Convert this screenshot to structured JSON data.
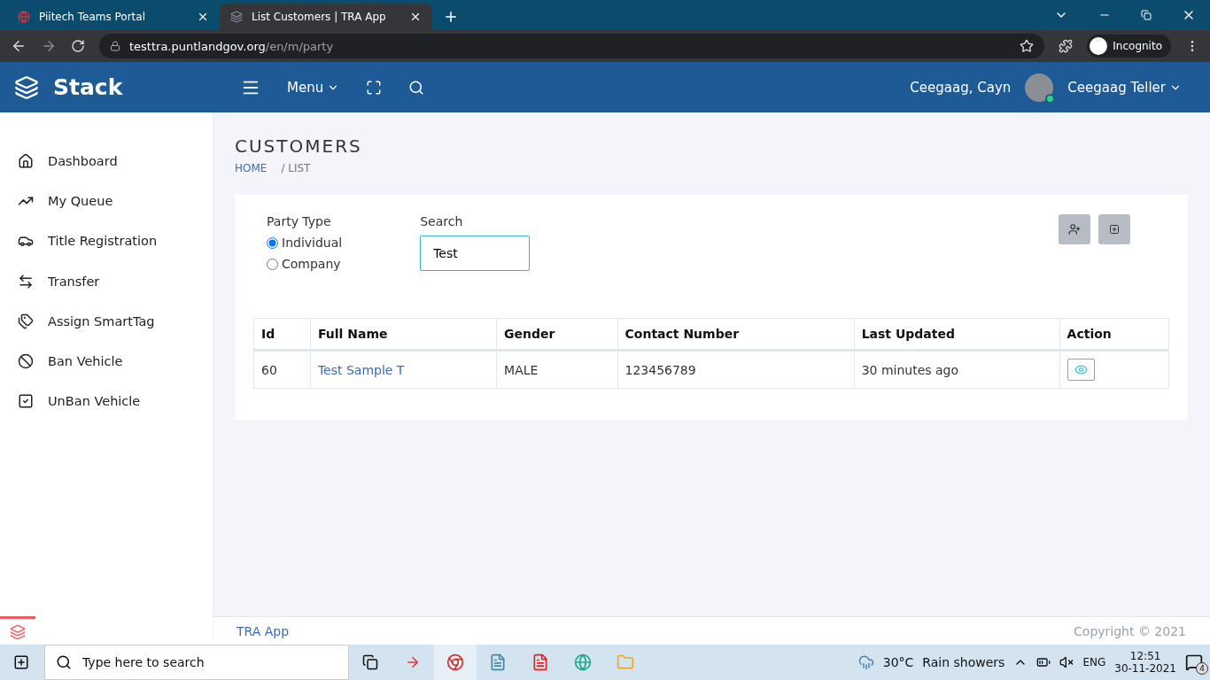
{
  "browser": {
    "tabs": [
      {
        "title": "Piitech Teams Portal",
        "selected": false
      },
      {
        "title": "List Customers | TRA App",
        "selected": true
      }
    ],
    "address": {
      "host": "testtra.puntlandgov.org",
      "path": "/en/m/party"
    },
    "profile": "Incognito"
  },
  "header": {
    "brand": "Stack",
    "menu": "Menu",
    "user_short": "Ceegaag, Cayn",
    "user_name": "Ceegaag Teller",
    "online": true
  },
  "sidebar": {
    "items": [
      {
        "label": "Dashboard"
      },
      {
        "label": "My Queue"
      },
      {
        "label": "Title Registration"
      },
      {
        "label": "Transfer"
      },
      {
        "label": "Assign SmartTag"
      },
      {
        "label": "Ban Vehicle"
      },
      {
        "label": "UnBan Vehicle"
      }
    ]
  },
  "page": {
    "title": "CUSTOMERS",
    "breadcrumb": [
      {
        "label": "HOME",
        "link": true
      },
      {
        "label": "/ LIST",
        "link": false
      }
    ]
  },
  "filters": {
    "party_type_label": "Party Type",
    "options": [
      {
        "label": "Individual",
        "selected": true
      },
      {
        "label": "Company",
        "selected": false
      }
    ],
    "search_label": "Search",
    "search_value": "Test"
  },
  "table": {
    "columns": [
      "Id",
      "Full Name",
      "Gender",
      "Contact Number",
      "Last Updated",
      "Action"
    ],
    "rows": [
      {
        "cells": [
          "60",
          "Test Sample T",
          "MALE",
          "123456789",
          "30 minutes ago"
        ]
      }
    ]
  },
  "footer": {
    "left": "TRA App",
    "right": "Copyright © 2021"
  },
  "taskbar": {
    "search_placeholder": "Type here to search",
    "temperature": "30°C",
    "weather": "Rain showers",
    "language": "ENG",
    "time": "12:51",
    "date": "30-11-2021",
    "notifications": "4"
  }
}
